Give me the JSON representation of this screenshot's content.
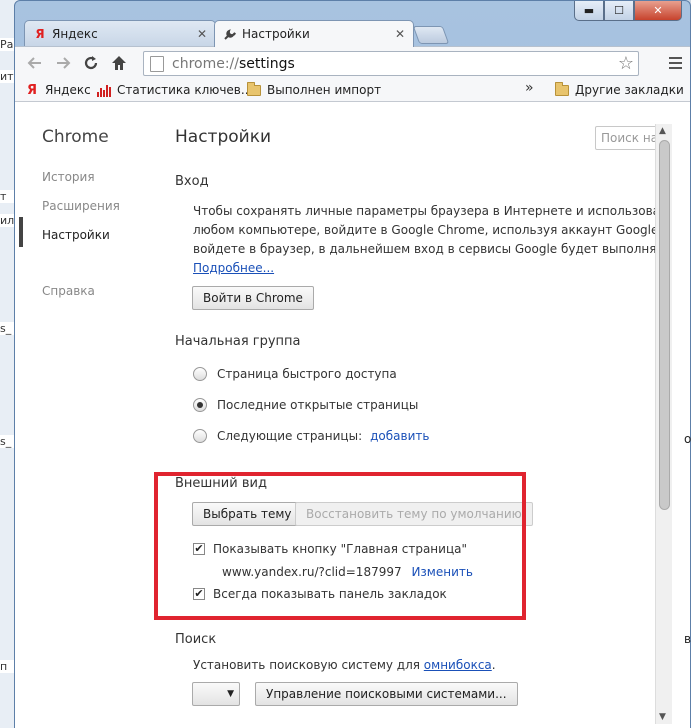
{
  "window": {
    "minimize": "▬",
    "maximize": "☐",
    "close": "✕"
  },
  "tabs": [
    {
      "label": "Яндекс",
      "icon": "yandex-icon",
      "close": "✕"
    },
    {
      "label": "Настройки",
      "icon": "wrench-icon",
      "close": "✕"
    }
  ],
  "omnibox": {
    "scheme": "chrome://",
    "host": "settings"
  },
  "bookmarks": [
    {
      "label": "Яндекс",
      "icon": "yandex-icon"
    },
    {
      "label": "Статистика ключев...",
      "icon": "stats-icon"
    },
    {
      "label": "Выполнен импорт",
      "icon": "folder-icon"
    }
  ],
  "bookmarks_overflow": "»",
  "other_bookmarks": "Другие закладки",
  "sidebar": {
    "brand": "Chrome",
    "items": [
      "История",
      "Расширения",
      "Настройки",
      "Справка"
    ],
    "active": "Настройки"
  },
  "page": {
    "title": "Настройки",
    "search_placeholder": "Поиск настроек"
  },
  "signin": {
    "title": "Вход",
    "lines": [
      "Чтобы сохранять личные параметры браузера в Интернете и использовать их в Google Chrome на любом",
      "любом компьютере, войдите в Google Chrome, используя аккаунт Google. Кроме того, если вы",
      "войдете в браузер, в дальнейшем вход в сервисы Google будет выполняться автоматически."
    ],
    "more_link": "Подробнее...",
    "button": "Войти в Chrome"
  },
  "startup": {
    "title": "Начальная группа",
    "options": [
      "Страница быстрого доступа",
      "Последние открытые страницы",
      "Следующие страницы:"
    ],
    "selected": 1,
    "add_link": "добавить"
  },
  "appearance": {
    "title": "Внешний вид",
    "choose_theme": "Выбрать тему",
    "reset_theme": "Восстановить тему по умолчанию",
    "show_home": "Показывать кнопку \"Главная страница\"",
    "home_url": "www.yandex.ru/?clid=187997",
    "change_link": "Изменить",
    "show_bookmarks": "Всегда показывать панель закладок"
  },
  "search": {
    "title": "Поиск",
    "text_prefix": "Установить поисковую систему для ",
    "omnibox_link": "омнибокса",
    "text_suffix": ".",
    "manage_button": "Управление поисковыми системами..."
  },
  "left_strip": [
    "Ра",
    "ит",
    "т",
    "ил",
    "s_",
    "s_",
    "п"
  ],
  "right_edge": [
    "о",
    "в"
  ],
  "colors": {
    "highlight": "#e0242f",
    "link": "#1a50b8"
  }
}
